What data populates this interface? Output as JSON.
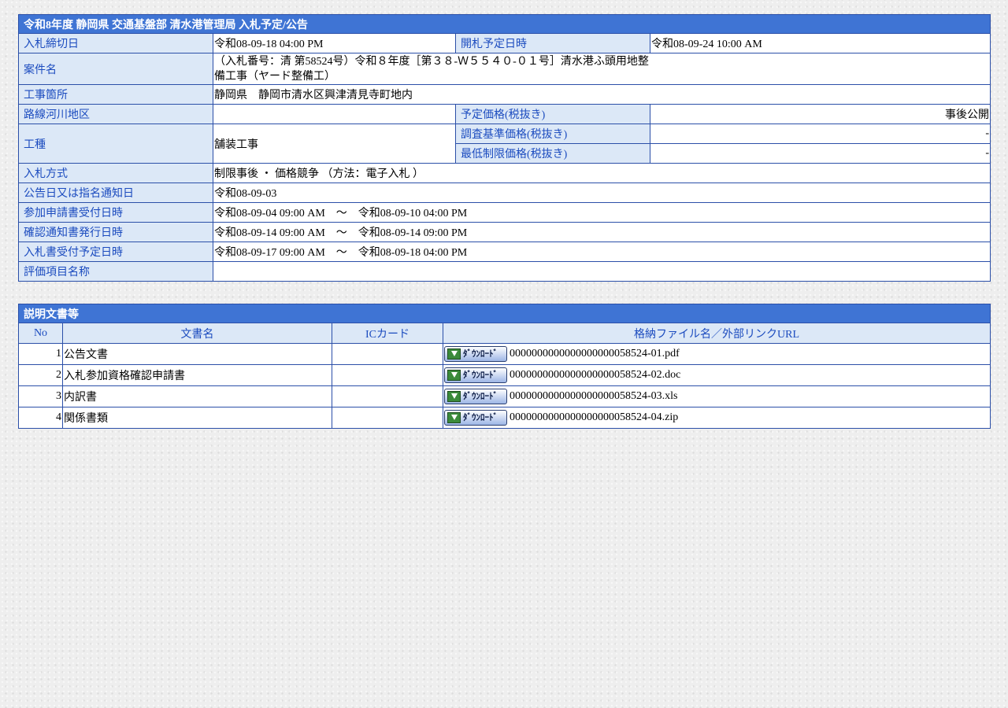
{
  "notice": {
    "title": "令和8年度 静岡県 交通基盤部 清水港管理局 入札予定/公告",
    "bid_deadline_label": "入札締切日",
    "bid_deadline_value": "令和08-09-18 04:00 PM",
    "opening_label": "開札予定日時",
    "opening_value": "令和08-09-24 10:00 AM",
    "project_label": "案件名",
    "project_value": "（入札番号：清 第58524号）令和８年度［第３８-Ｗ５５４０-０１号］清水港ふ頭用地整備工事（ヤード整備工）",
    "location_label": "工事箇所",
    "location_value": "静岡県　静岡市清水区興津清見寺町地内",
    "route_label": "路線河川地区",
    "route_value": "",
    "planned_price_label": "予定価格(税抜き)",
    "planned_price_value": "事後公開",
    "work_type_label": "工種",
    "work_type_value": "舗装工事",
    "survey_price_label": "調査基準価格(税抜き)",
    "survey_price_value": "-",
    "min_price_label": "最低制限価格(税抜き)",
    "min_price_value": "-",
    "method_label": "入札方式",
    "method_value": "制限事後 ・ 価格競争 （方法：電子入札 ）",
    "announce_label": "公告日又は指名通知日",
    "announce_value": "令和08-09-03",
    "apply_label": "参加申請書受付日時",
    "apply_value": "令和08-09-04 09:00 AM　～　令和08-09-10 04:00 PM",
    "confirm_label": "確認通知書発行日時",
    "confirm_value": "令和08-09-14 09:00 AM　～　令和08-09-14 09:00 PM",
    "bidform_label": "入札書受付予定日時",
    "bidform_value": "令和08-09-17 09:00 AM　～　令和08-09-18 04:00 PM",
    "eval_label": "評価項目名称",
    "eval_value": ""
  },
  "documents": {
    "title": "説明文書等",
    "headers": {
      "no": "No",
      "name": "文書名",
      "ic": "ICカード",
      "file": "格納ファイル名／外部リンクURL"
    },
    "button_label": "ﾀﾞｳﾝﾛｰﾄﾞ",
    "rows": [
      {
        "no": "1",
        "name": "公告文書",
        "ic": "",
        "file": "0000000000000000000058524-01.pdf"
      },
      {
        "no": "2",
        "name": "入札参加資格確認申請書",
        "ic": "",
        "file": "0000000000000000000058524-02.doc"
      },
      {
        "no": "3",
        "name": "内訳書",
        "ic": "",
        "file": "0000000000000000000058524-03.xls"
      },
      {
        "no": "4",
        "name": "関係書類",
        "ic": "",
        "file": "0000000000000000000058524-04.zip"
      }
    ]
  }
}
